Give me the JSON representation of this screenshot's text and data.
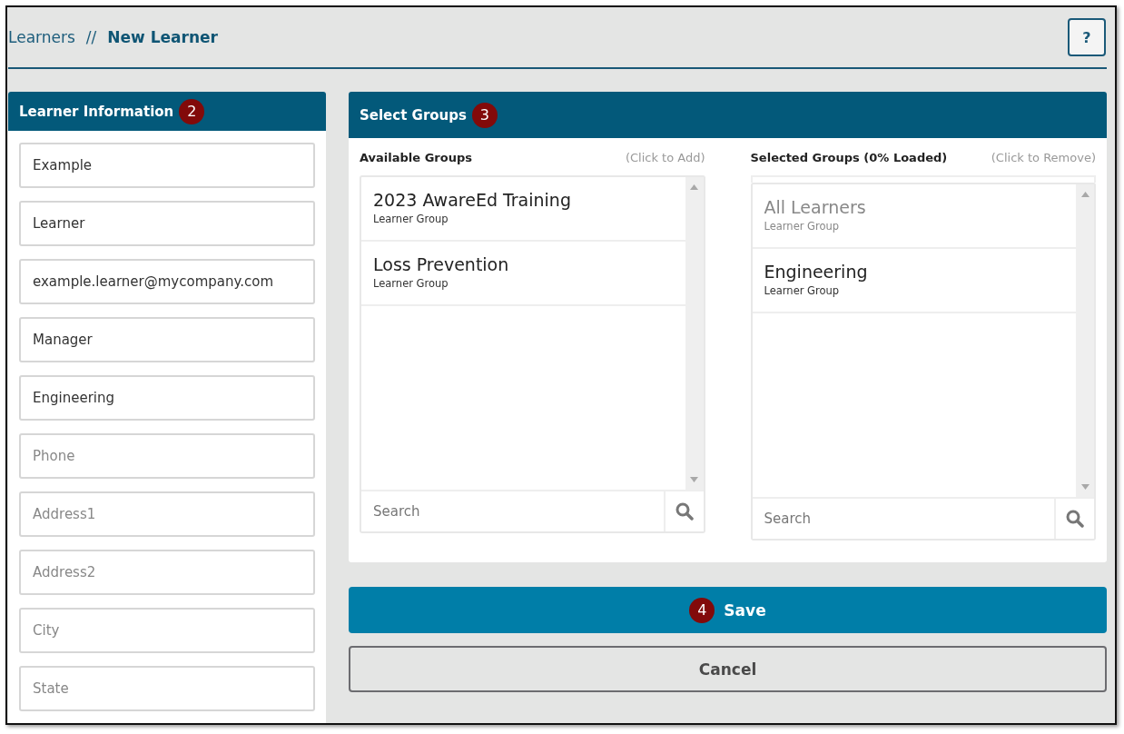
{
  "breadcrumb": [
    {
      "label": "Learners",
      "current": false
    },
    {
      "label": "New Learner",
      "current": true
    }
  ],
  "breadcrumb_separator": "//",
  "help_button": "?",
  "learner_information": {
    "title": "Learner Information",
    "badge": "2",
    "fields": [
      {
        "value": "Example"
      },
      {
        "value": "Learner"
      },
      {
        "value": "example.learner@mycompany.com"
      },
      {
        "value": "Manager"
      },
      {
        "value": "Engineering"
      },
      {
        "placeholder": "Phone"
      },
      {
        "placeholder": "Address1"
      },
      {
        "placeholder": "Address2"
      },
      {
        "placeholder": "City"
      },
      {
        "placeholder": "State"
      }
    ]
  },
  "select_groups": {
    "title": "Select Groups",
    "badge": "3",
    "lists": [
      {
        "title": "Available Groups",
        "hint": "(Click to Add)",
        "search_placeholder": "Search",
        "items": [
          {
            "name": "2023 AwareEd Training",
            "type": "Learner Group",
            "disabled": false
          },
          {
            "name": "Loss Prevention",
            "type": "Learner Group",
            "disabled": false
          }
        ]
      },
      {
        "title": "Selected Groups (0% Loaded)",
        "hint": "(Click to Remove)",
        "search_placeholder": "Search",
        "items": [
          {
            "name": "All Learners",
            "type": "Learner Group",
            "disabled": true
          },
          {
            "name": "Engineering",
            "type": "Learner Group",
            "disabled": false
          }
        ]
      }
    ]
  },
  "save_button": {
    "label": "Save",
    "badge": "4"
  },
  "cancel_button": {
    "label": "Cancel"
  }
}
